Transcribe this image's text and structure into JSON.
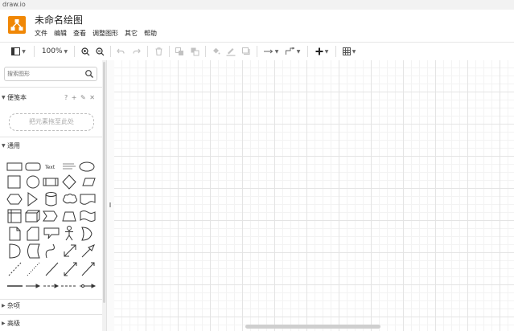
{
  "window": {
    "title": "draw.io"
  },
  "document": {
    "title": "未命名绘图"
  },
  "menu": {
    "items": [
      "文件",
      "编辑",
      "查看",
      "调整图形",
      "其它",
      "帮助"
    ]
  },
  "toolbar": {
    "zoom_label": "100%"
  },
  "sidebar": {
    "search_placeholder": "搜索图形",
    "scratchpad": {
      "label": "便笺本",
      "tools": "? + ✎ ✕",
      "drop_hint": "把元素拖至此处"
    },
    "general": {
      "label": "通用",
      "text_shape": "Text"
    },
    "misc": {
      "label": "杂项"
    },
    "advanced": {
      "label": "高级"
    }
  },
  "colors": {
    "logo": "#f08705",
    "grid_major": "#e4e4e4",
    "grid_minor": "#f3f3f3"
  }
}
